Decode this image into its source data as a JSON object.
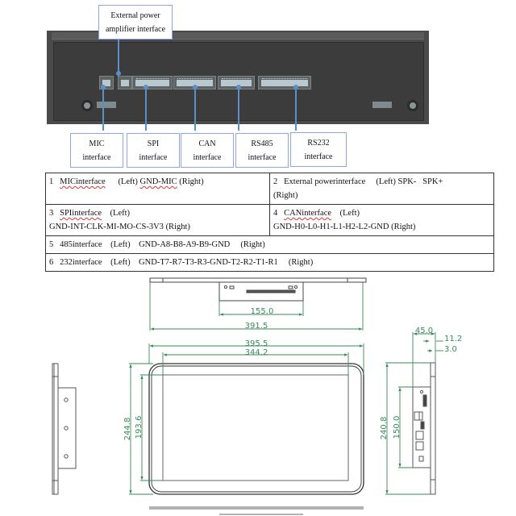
{
  "photo_callouts": {
    "top": {
      "line1": "External power",
      "line2": "amplifier interface"
    },
    "bottom": [
      {
        "line1": "MIC",
        "line2": "interface"
      },
      {
        "line1": "SPI",
        "line2": "interface"
      },
      {
        "line1": "CAN",
        "line2": "interface"
      },
      {
        "line1": "RS485",
        "line2": "interface"
      },
      {
        "line1": "RS232",
        "line2": "interface"
      }
    ]
  },
  "pin_table": {
    "rows": [
      [
        {
          "num": "1",
          "name": "MICinterface",
          "side_left": "(Left)",
          "pins": "GND-MIC",
          "side_right": "(Right)"
        },
        {
          "num": "2",
          "name": "External powerinterface",
          "side_left": "(Left)",
          "pins": "SPK-   SPK+",
          "side_right": "(Right)"
        }
      ],
      [
        {
          "num": "3",
          "name": "SPIinterface",
          "side_left": "(Left)",
          "pins": "GND-INT-CLK-MI-MO-CS-3V3",
          "side_right": "(Right)"
        },
        {
          "num": "4",
          "name": "CANinterface",
          "side_left": "(Left)",
          "pins": "GND-H0-L0-H1-L1-H2-L2-GND",
          "side_right": "(Right)"
        }
      ]
    ],
    "full_rows": [
      {
        "num": "5",
        "name": "485interface",
        "side_left": "(Left)",
        "pins": "GND-A8-B8-A9-B9-GND",
        "side_right": "(Right)"
      },
      {
        "num": "6",
        "name": "232interface",
        "side_left": "(Left)",
        "pins": "GND-T7-R7-T3-R3-GND-T2-R2-T1-R1",
        "side_right": "(Right)"
      }
    ]
  },
  "dimensions": {
    "top_view": {
      "box_width": "155.0",
      "overall_width": "391.5"
    },
    "front_view": {
      "outer_width": "395.5",
      "screen_width": "344.2",
      "outer_height": "244.8",
      "screen_height": "193.6"
    },
    "side_view": {
      "depth": "45.0",
      "bezel": "11.2",
      "glass": "3.0",
      "height": "240.8",
      "box_height": "150.0"
    }
  },
  "colors": {
    "dimension": "#3a8a5a",
    "callout_border": "#8ea6e8",
    "leader": "#5b8fc9"
  }
}
